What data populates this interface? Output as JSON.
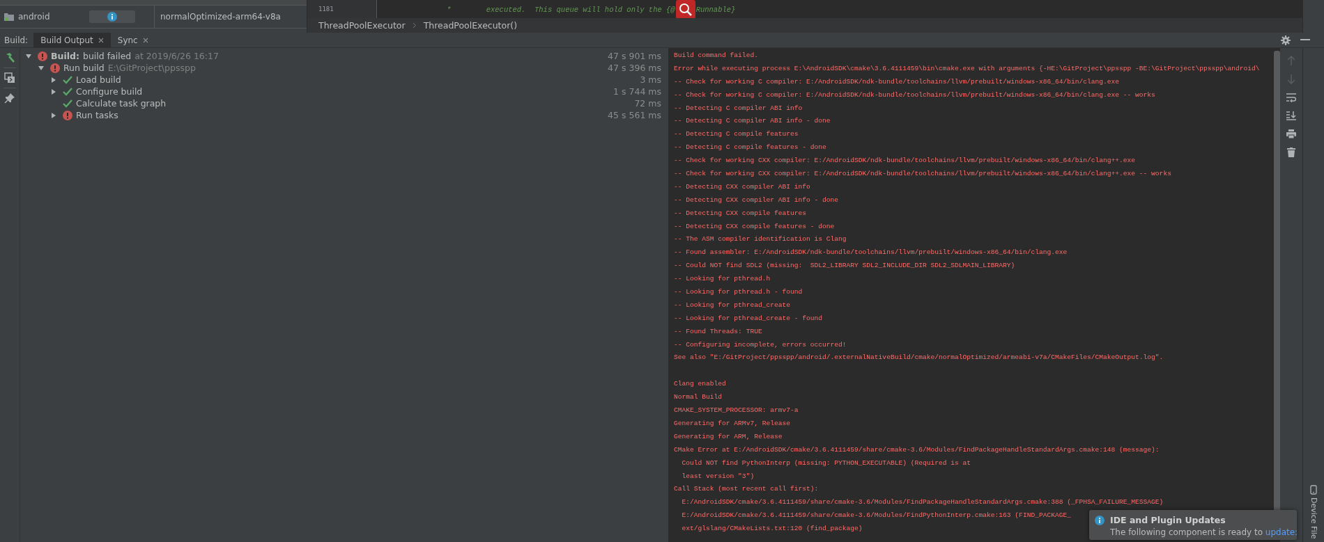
{
  "module_panel": {
    "rows": [
      {
        "module": "android",
        "variant": "normalOptimized-arm64-v8a"
      }
    ]
  },
  "editor": {
    "line_number": "1181",
    "code_before": "*        executed.  This queue will hold only the {@",
    "code_after": "Runnable}",
    "breadcrumbs": [
      "ThreadPoolExecutor",
      "ThreadPoolExecutor()"
    ]
  },
  "build_panel": {
    "label": "Build:",
    "tabs": [
      {
        "label": "Build Output",
        "selected": true
      },
      {
        "label": "Sync",
        "selected": false
      }
    ],
    "tree": [
      {
        "kind": "error",
        "label": "Build:",
        "label_rest": "build failed",
        "detail": "at 2019/6/26 16:17",
        "time": "47 s 901 ms",
        "expanded": true,
        "children": [
          {
            "kind": "error",
            "label": "Run build",
            "detail": "E:\\GitProject\\ppsspp",
            "time": "47 s 396 ms",
            "expanded": true,
            "children": [
              {
                "kind": "success",
                "label": "Load build",
                "time": "3 ms",
                "expanded": false
              },
              {
                "kind": "success",
                "label": "Configure build",
                "time": "1 s 744 ms",
                "expanded": false
              },
              {
                "kind": "success",
                "label": "Calculate task graph",
                "time": "72 ms"
              },
              {
                "kind": "error",
                "label": "Run tasks",
                "time": "45 s 561 ms",
                "expanded": false
              }
            ]
          }
        ]
      }
    ],
    "console": {
      "blocks": [
        {
          "lines": [
            "Build command failed.",
            "Error while executing process E:\\AndroidSDK\\cmake\\3.6.4111459\\bin\\cmake.exe with arguments {-HE:\\GitProject\\ppsspp -BE:\\GitProject\\ppsspp\\android\\",
            "-- Check for working C compiler: E:/AndroidSDK/ndk-bundle/toolchains/llvm/prebuilt/windows-x86_64/bin/clang.exe",
            "-- Check for working C compiler: E:/AndroidSDK/ndk-bundle/toolchains/llvm/prebuilt/windows-x86_64/bin/clang.exe -- works",
            "-- Detecting C compiler ABI info",
            "-- Detecting C compiler ABI info - done",
            "-- Detecting C compile features",
            "-- Detecting C compile features - done",
            "-- Check for working CXX compiler: E:/AndroidSDK/ndk-bundle/toolchains/llvm/prebuilt/windows-x86_64/bin/clang++.exe",
            "-- Check for working CXX compiler: E:/AndroidSDK/ndk-bundle/toolchains/llvm/prebuilt/windows-x86_64/bin/clang++.exe -- works",
            "-- Detecting CXX compiler ABI info",
            "-- Detecting CXX compiler ABI info - done",
            "-- Detecting CXX compile features",
            "-- Detecting CXX compile features - done",
            "-- The ASM compiler identification is Clang",
            "-- Found assembler: E:/AndroidSDK/ndk-bundle/toolchains/llvm/prebuilt/windows-x86_64/bin/clang.exe",
            "-- Could NOT find SDL2 (missing:  SDL2_LIBRARY SDL2_INCLUDE_DIR SDL2_SDLMAIN_LIBRARY)",
            "-- Looking for pthread.h",
            "-- Looking for pthread.h - found",
            "-- Looking for pthread_create",
            "-- Looking for pthread_create - found",
            "-- Found Threads: TRUE",
            "-- Configuring incomplete, errors occurred!",
            "See also \"E:/GitProject/ppsspp/android/.externalNativeBuild/cmake/normalOptimized/armeabi-v7a/CMakeFiles/CMakeOutput.log\"."
          ]
        },
        {
          "lines": [
            "Clang enabled",
            "Normal Build",
            "CMAKE_SYSTEM_PROCESSOR: armv7-a",
            "Generating for ARMv7, Release",
            "Generating for ARM, Release",
            "CMake Error at E:/AndroidSDK/cmake/3.6.4111459/share/cmake-3.6/Modules/FindPackageHandleStandardArgs.cmake:148 (message):",
            "  Could NOT find PythonInterp (missing: PYTHON_EXECUTABLE) (Required is at",
            "  least version \"3\")",
            "Call Stack (most recent call first):",
            "  E:/AndroidSDK/cmake/3.6.4111459/share/cmake-3.6/Modules/FindPackageHandleStandardArgs.cmake:388 (_FPHSA_FAILURE_MESSAGE)",
            "  E:/AndroidSDK/cmake/3.6.4111459/share/cmake-3.6/Modules/FindPythonInterp.cmake:163 (FIND_PACKAGE_",
            "  ext/glslang/CMakeLists.txt:120 (find_package)"
          ]
        }
      ]
    }
  },
  "side_strip": {
    "label": "Device File"
  },
  "notification": {
    "title": "IDE and Plugin Updates",
    "text": "The following component is ready to",
    "link": "update:"
  }
}
